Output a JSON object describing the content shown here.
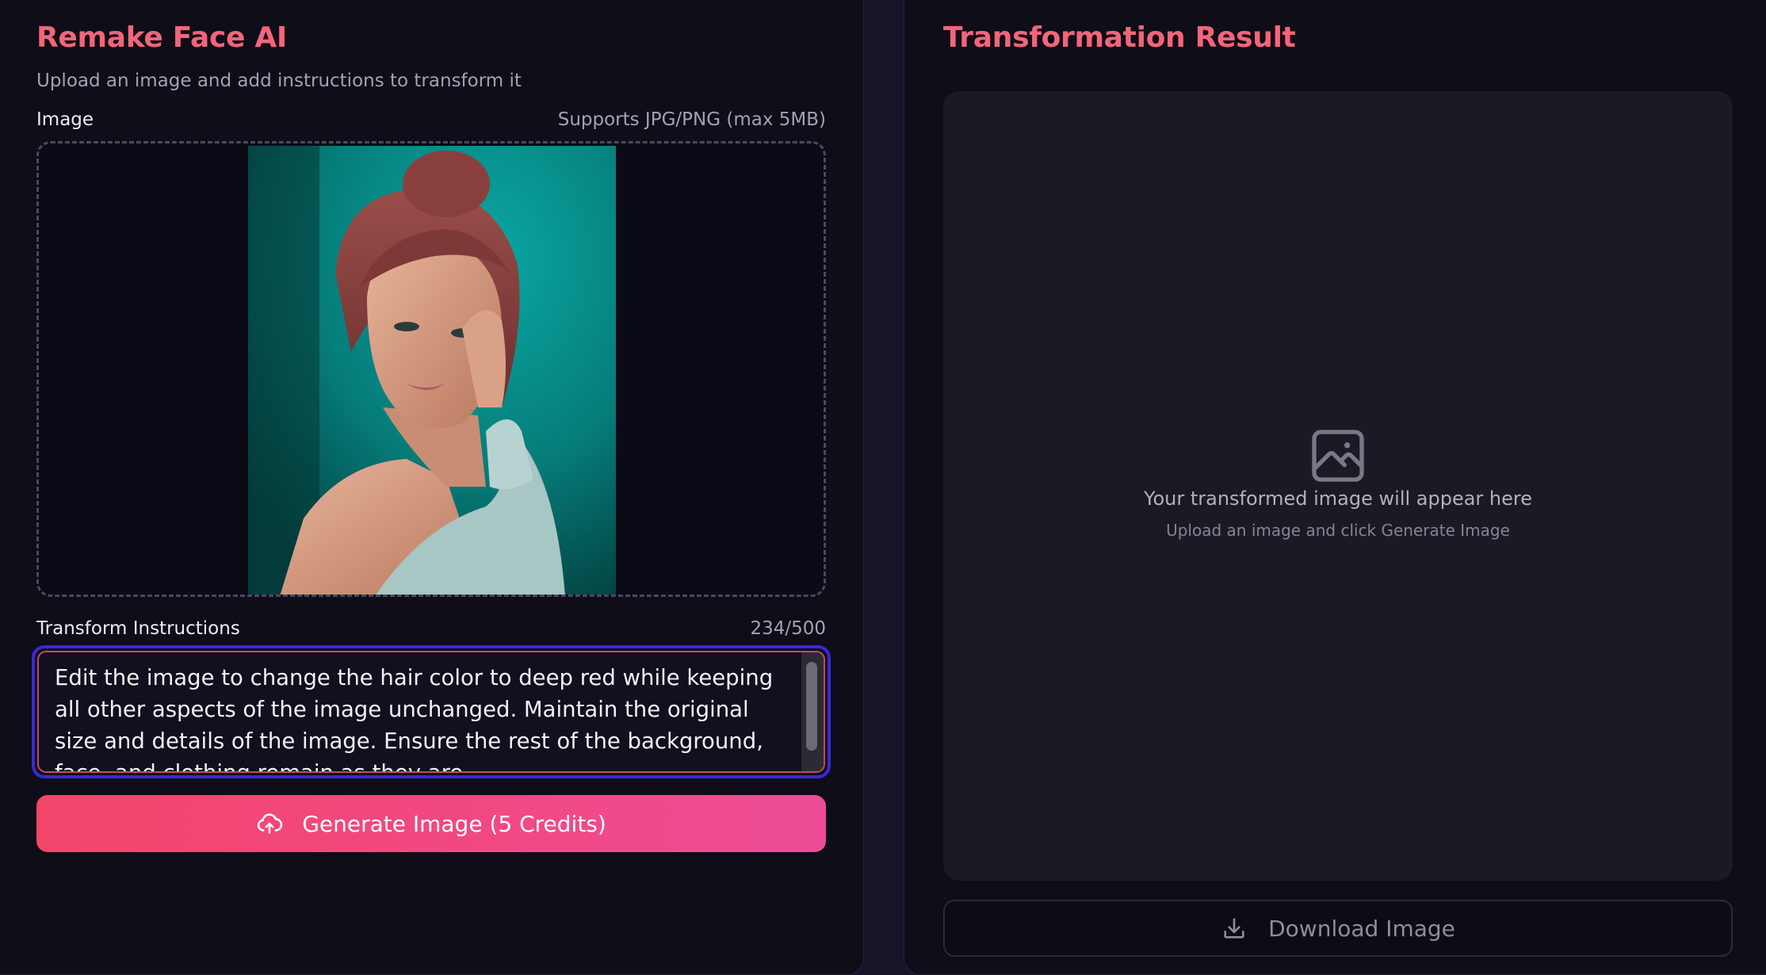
{
  "left_panel": {
    "title": "Remake Face AI",
    "subtitle": "Upload an image and add instructions to transform it",
    "image_label": "Image",
    "image_hint": "Supports JPG/PNG (max 5MB)",
    "instructions_label": "Transform Instructions",
    "char_count": "234/500",
    "instructions_text": "Edit the image to change the hair color to deep red while keeping all other aspects of the image unchanged. Maintain the original size and details of the image. Ensure the rest of the background, face, and clothing remain as they are.",
    "generate_button": "Generate Image (5 Credits)",
    "generate_icon": "cloud-upload-icon"
  },
  "right_panel": {
    "title": "Transformation Result",
    "placeholder_icon": "image-icon",
    "placeholder_main": "Your transformed image will appear here",
    "placeholder_sub": "Upload an image and click Generate Image",
    "download_button": "Download Image",
    "download_icon": "download-icon"
  },
  "colors": {
    "accent": "#f2657a",
    "button_gradient_start": "#f3456a",
    "button_gradient_end": "#ee4c96",
    "focus_ring": "#3a28d9",
    "background": "#0e0d18"
  }
}
